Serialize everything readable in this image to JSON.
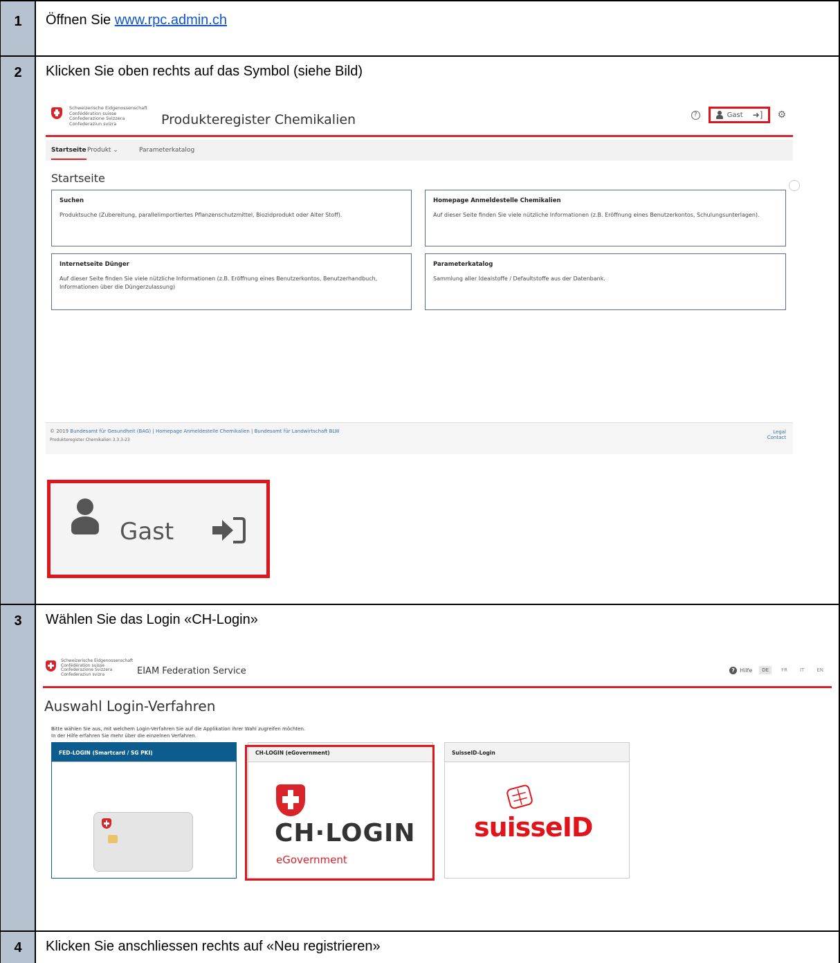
{
  "steps": [
    {
      "num": "1",
      "text_prefix": "Öffnen Sie ",
      "link": "www.rpc.admin.ch"
    },
    {
      "num": "2",
      "text": "Klicken Sie oben rechts auf das Symbol (siehe Bild)"
    },
    {
      "num": "3",
      "text": "Wählen Sie das Login «CH-Login»"
    },
    {
      "num": "4",
      "text": "Klicken Sie anschliessen rechts auf «Neu registrieren»"
    }
  ],
  "confederation": [
    "Schweizerische Eidgenossenschaft",
    "Confédération suisse",
    "Confederazione Svizzera",
    "Confederaziun svizra"
  ],
  "screen1": {
    "app_title": "Produkteregister Chemikalien",
    "help_icon": "?",
    "user_label": "Gast",
    "nav": [
      "Startseite",
      "Produkt ⌄",
      "Parameterkatalog"
    ],
    "page_heading": "Startseite",
    "cards": [
      {
        "title": "Suchen",
        "body": "Produktsuche (Zubereitung, parallelimportiertes Pflanzenschutzmittel, Biozidprodukt oder Alter Stoff)."
      },
      {
        "title": "Homepage Anmeldestelle Chemikalien",
        "body": "Auf dieser Seite finden Sie viele nützliche Informationen (z.B. Eröffnung eines Benutzerkontos, Schulungsunterlagen)."
      },
      {
        "title": "Internetseite Dünger",
        "body": "Auf dieser Seite finden Sie viele nützliche Informationen (z.B. Eröffnung eines Benutzerkontos, Benutzerhandbuch, Informationen über die Düngerzulassung)"
      },
      {
        "title": "Parameterkatalog",
        "body": "Sammlung aller Idealstoffe / Defaultstoffe aus der Datenbank."
      }
    ],
    "footer": {
      "copyright": "© 2019",
      "link1": "Bundesamt für Gesundheit (BAG)",
      "link2": "Homepage Anmeldestelle Chemikalien",
      "link3": "Bundesamt für Landwirtschaft BLW",
      "version": "Produkteregister Chemikalien 3.3.3-23",
      "legal": "Legal",
      "contact": "Contact"
    }
  },
  "zoom": {
    "user_label": "Gast"
  },
  "screen2": {
    "app_title": "EIAM Federation Service",
    "help_label": "Hilfe",
    "languages": [
      "DE",
      "FR",
      "IT",
      "EN"
    ],
    "heading": "Auswahl Login-Verfahren",
    "intro1": "Bitte wählen Sie aus, mit welchem Login-Verfahren Sie auf die Applikation ihrer Wahl zugreifen möchten.",
    "intro2": "In der Hilfe erfahren Sie mehr über die einzelnen Verfahren.",
    "options": [
      {
        "label": "FED-LOGIN (Smartcard / SG PKI)"
      },
      {
        "label": "CH-LOGIN (eGovernment)",
        "logo_text": "CH·LOGIN",
        "logo_sub": "eGovernment"
      },
      {
        "label": "SuisseID-Login",
        "logo_text": "suisseID"
      }
    ]
  }
}
